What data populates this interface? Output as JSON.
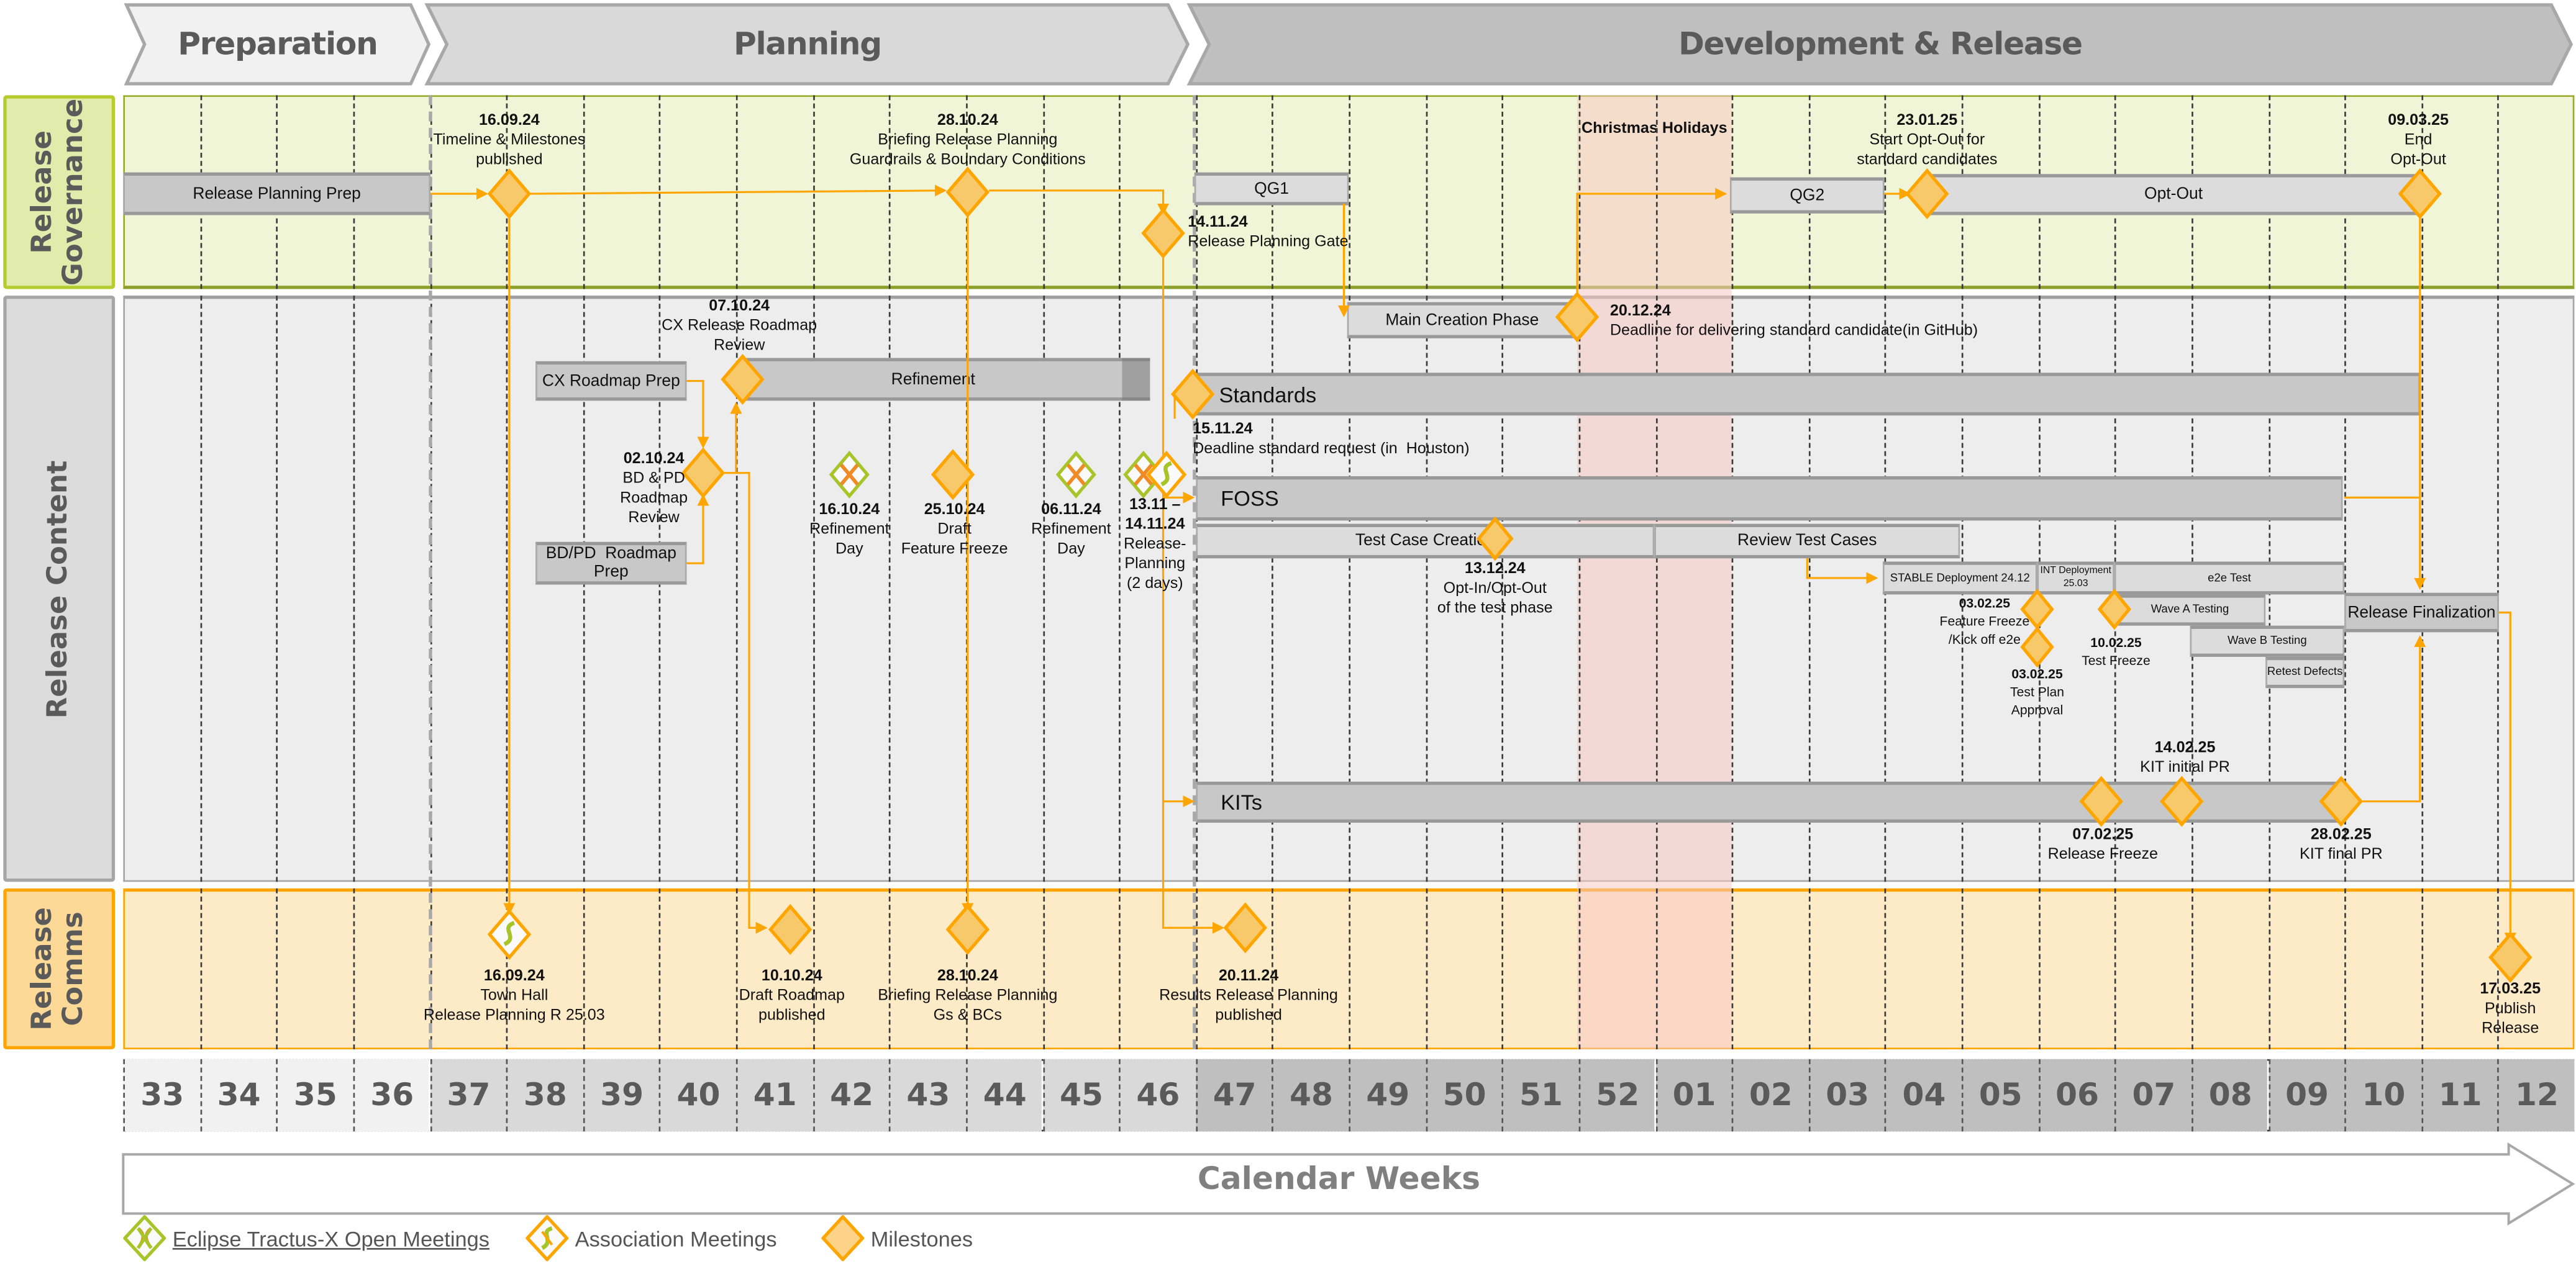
{
  "phases": [
    {
      "label": "Preparation"
    },
    {
      "label": "Planning"
    },
    {
      "label": "Development & Release"
    }
  ],
  "rows": {
    "governance": {
      "label": "Release\nGovernance"
    },
    "content": {
      "label": "Release Content"
    },
    "comms": {
      "label": "Release\nComms"
    }
  },
  "colors": {
    "governance_bg": "#eff5d6",
    "governance_border": "#b5cc2e",
    "content_bg": "#ededed",
    "comms_bg": "#fdebc8",
    "comms_border": "#ffa500",
    "milestone_fill": "#f8c96a",
    "milestone_stroke": "#ffa500",
    "christmas": "#f8ddd8"
  },
  "christmas": {
    "label": "Christmas Holidays"
  },
  "governance": {
    "bars": {
      "release_planning_prep": "Release Planning Prep",
      "qg1": "QG1",
      "qg2": "QG2",
      "opt_out": "Opt-Out"
    },
    "milestones": [
      {
        "date": "16.09.24",
        "text": "Timeline & Milestones\npublished"
      },
      {
        "date": "28.10.24",
        "text": "Briefing Release Planning\nGuardrails & Boundary Conditions"
      },
      {
        "date": "14.11.24",
        "text": "Release Planning Gate"
      },
      {
        "date": "23.01.25",
        "text": "Start Opt-Out for\nstandard candidates"
      },
      {
        "date": "09.03.25",
        "text": "End\nOpt-Out"
      }
    ]
  },
  "content": {
    "bars": {
      "cx_roadmap_prep": "CX Roadmap Prep",
      "bdpd_roadmap_prep": "BD/PD  Roadmap\nPrep",
      "refinement": "Refinement",
      "main_creation": "Main Creation Phase",
      "standards": "Standards",
      "foss": "FOSS",
      "test_case_creation": "Test Case Creation",
      "review_test_cases": "Review Test Cases",
      "stable_deployment": "STABLE Deployment 24.12",
      "int_deployment": "INT Deployment\n25.03",
      "e2e_test": "e2e Test",
      "wave_a": "Wave A Testing",
      "wave_b": "Wave B Testing",
      "retest": "Retest Defects",
      "release_finalization": "Release Finalization",
      "kits": "KITs"
    },
    "milestones": [
      {
        "date": "07.10.24",
        "text": "CX Release Roadmap\nReview"
      },
      {
        "date": "02.10.24",
        "text": "BD & PD\nRoadmap\nReview"
      },
      {
        "date": "16.10.24",
        "text": "Refinement\nDay"
      },
      {
        "date": "25.10.24",
        "text": "Draft\nFeature Freeze"
      },
      {
        "date": "06.11.24",
        "text": "Refinement\nDay"
      },
      {
        "date": "13.11 –\n14.11.24",
        "text": "Release-\nPlanning\n(2 days)"
      },
      {
        "date": "15.11.24",
        "text": "Deadline standard request (in  Houston)"
      },
      {
        "date": "20.12.24",
        "text": "Deadline for delivering standard candidate(in GitHub)"
      },
      {
        "date": "13.12.24",
        "text": "Opt-In/Opt-Out\nof the test phase"
      },
      {
        "date": "03.02.25",
        "text": "Feature Freeze\n/Kick off e2e"
      },
      {
        "date": "03.02.25",
        "text": "Test Plan\nApproval"
      },
      {
        "date": "10.02.25",
        "text": "Test Freeze"
      },
      {
        "date": "07.02.25",
        "text": "Release Freeze"
      },
      {
        "date": "14.02.25",
        "text": "KIT initial PR"
      },
      {
        "date": "28.02.25",
        "text": "KIT final PR"
      }
    ]
  },
  "comms": {
    "milestones": [
      {
        "date": "16.09.24",
        "text": "Town Hall\nRelease Planning R 25.03"
      },
      {
        "date": "10.10.24",
        "text": "Draft Roadmap\npublished"
      },
      {
        "date": "28.10.24",
        "text": "Briefing Release Planning\nGs & BCs"
      },
      {
        "date": "20.11.24",
        "text": "Results Release Planning\npublished"
      },
      {
        "date": "17.03.25",
        "text": "Publish\nRelease"
      }
    ]
  },
  "weeks": [
    "33",
    "34",
    "35",
    "36",
    "37",
    "38",
    "39",
    "40",
    "41",
    "42",
    "43",
    "44",
    "45",
    "46",
    "47",
    "48",
    "49",
    "50",
    "51",
    "52",
    "01",
    "02",
    "03",
    "04",
    "05",
    "06",
    "07",
    "08",
    "09",
    "10",
    "11",
    "12"
  ],
  "calendar_label": "Calendar Weeks",
  "legend": [
    {
      "label": "Eclipse Tractus-X Open Meetings",
      "icon": "tractus-x-meeting-icon"
    },
    {
      "label": "Association Meetings",
      "icon": "association-meeting-icon"
    },
    {
      "label": "Milestones",
      "icon": "milestone-icon"
    }
  ]
}
